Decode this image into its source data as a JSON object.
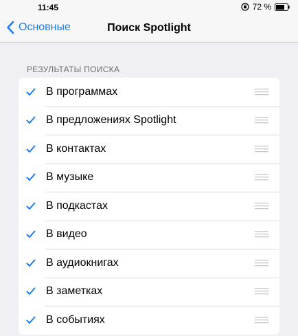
{
  "status_bar": {
    "time": "11:45",
    "battery_percent": "72 %"
  },
  "nav": {
    "back_label": "Основные",
    "title": "Поиск Spotlight"
  },
  "section": {
    "header": "РЕЗУЛЬТАТЫ ПОИСКА"
  },
  "items": [
    {
      "label": "В программах",
      "checked": true
    },
    {
      "label": "В предложениях Spotlight",
      "checked": true
    },
    {
      "label": "В контактах",
      "checked": true
    },
    {
      "label": "В музыке",
      "checked": true
    },
    {
      "label": "В подкастах",
      "checked": true
    },
    {
      "label": "В видео",
      "checked": true
    },
    {
      "label": "В аудиокнигах",
      "checked": true
    },
    {
      "label": "В заметках",
      "checked": true
    },
    {
      "label": "В событиях",
      "checked": true
    }
  ],
  "colors": {
    "accent": "#1a7cf5",
    "background": "#efeff4",
    "section_header": "#6d6d72"
  },
  "icons": {
    "back": "chevron-left-icon",
    "check": "checkmark-icon",
    "reorder": "reorder-grip-icon",
    "rotation_lock": "rotation-lock-icon",
    "battery": "battery-icon"
  }
}
